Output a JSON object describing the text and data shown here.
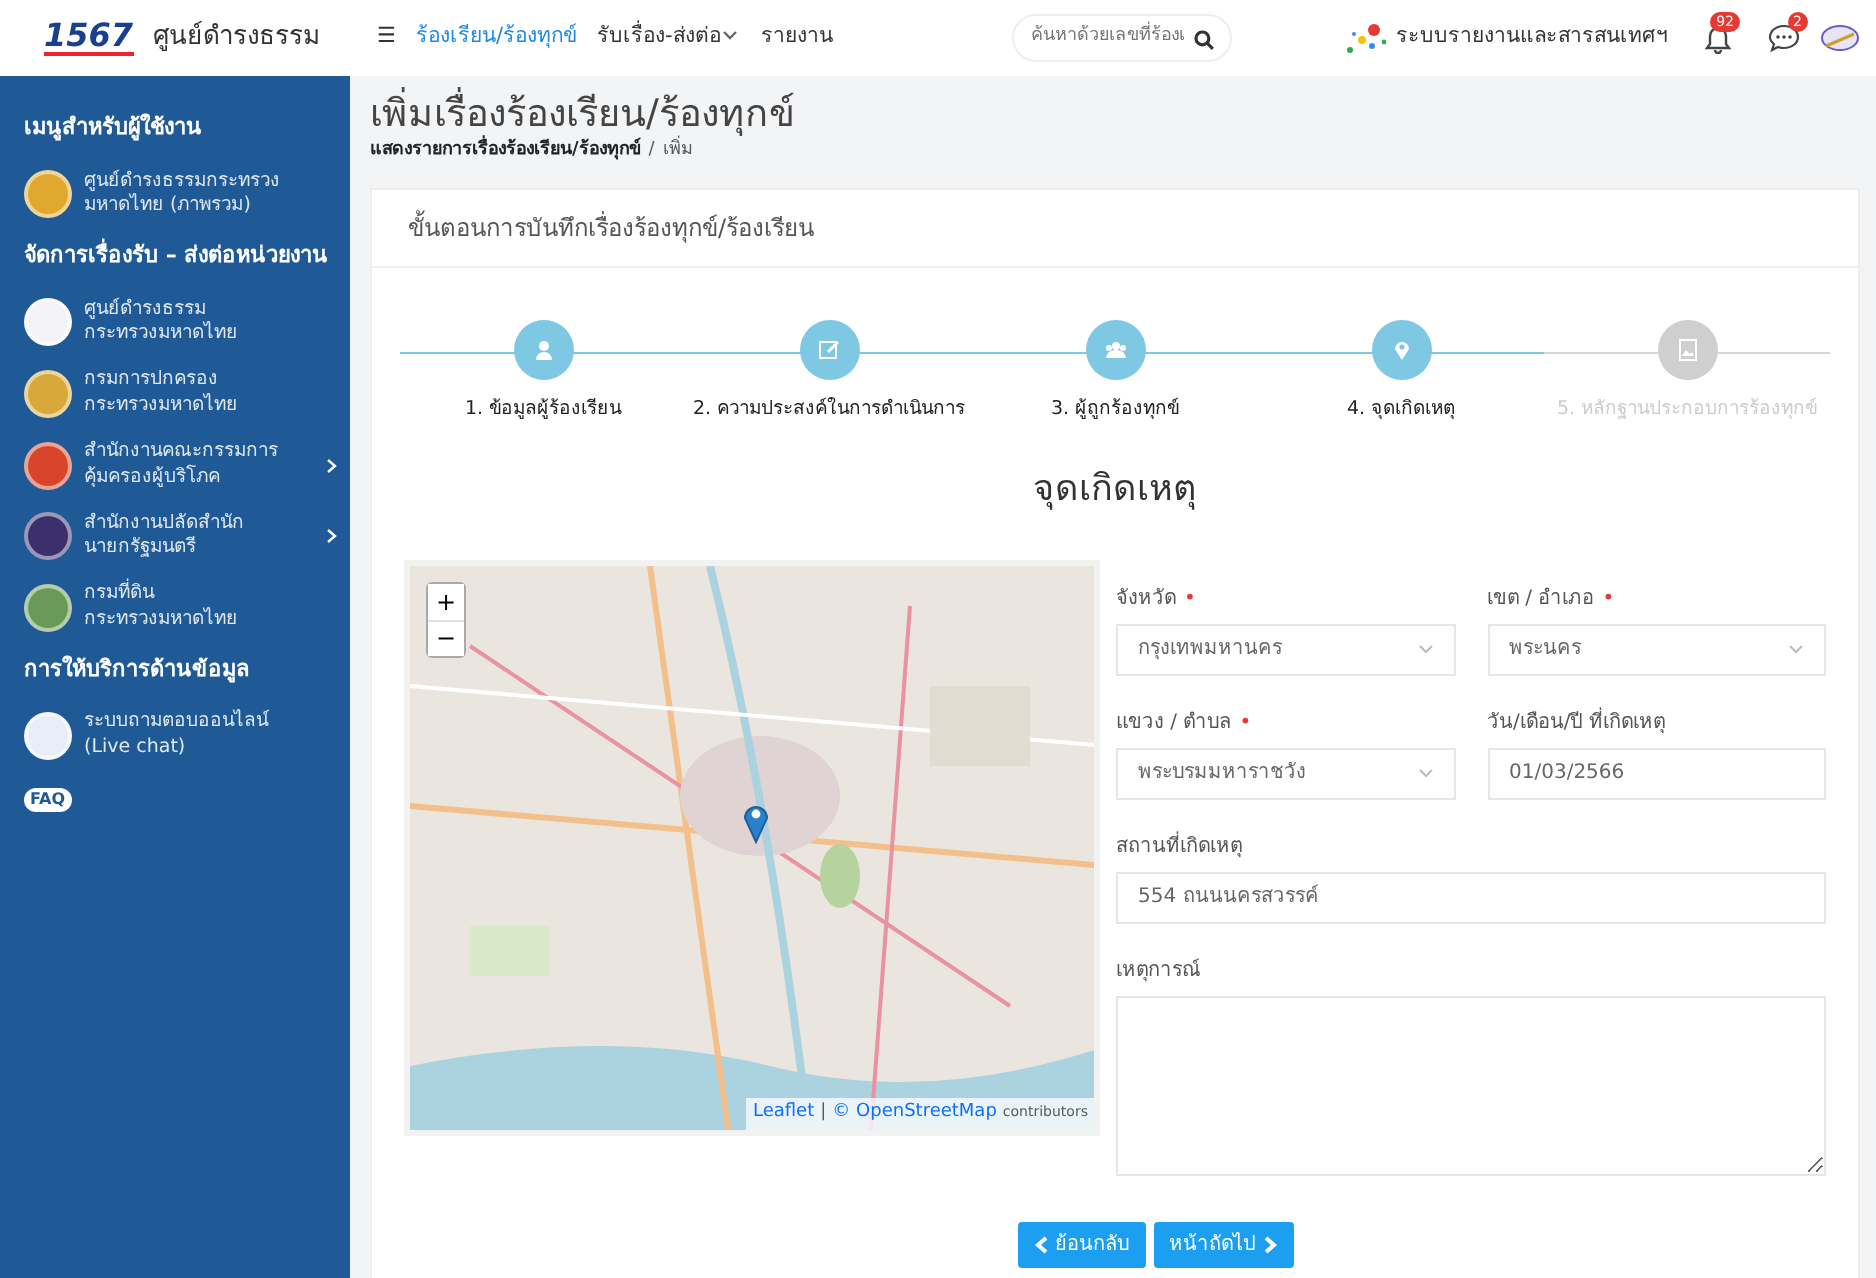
{
  "topbar": {
    "logo": "1567",
    "brand": "ศูนย์ดำรงธรรม",
    "menu_icon": "☰",
    "nav": [
      {
        "label": "ร้องเรียน/ร้องทุกข์",
        "selected": true,
        "dropdown": false
      },
      {
        "label": "รับเรื่อง-ส่งต่อ",
        "selected": false,
        "dropdown": true
      },
      {
        "label": "รายงาน",
        "selected": false,
        "dropdown": false
      }
    ],
    "search": {
      "placeholder": "ค้นหาด้วยเลขที่ร้องเ"
    },
    "report_link": "ระบบรายงานและสารสนเทศฯ",
    "notifications": [
      {
        "kind": "bell",
        "count": "92"
      },
      {
        "kind": "chat",
        "count": "2"
      }
    ]
  },
  "sidebar": {
    "sections": [
      {
        "title": "เมนูสำหรับผู้ใช้งาน",
        "items": [
          {
            "line1": "ศูนย์ดำรงธรรมกระทรวง",
            "line2": "มหาดไทย (ภาพรวม)",
            "color": "#e0a82e",
            "submenu": false
          }
        ]
      },
      {
        "title": "จัดการเรื่องรับ – ส่งต่อหน่วยงาน",
        "items": [
          {
            "line1": "ศูนย์ดำรงธรรม",
            "line2": "กระทรวงมหาดไทย",
            "color": "#f4f4f8",
            "submenu": false
          },
          {
            "line1": "กรมการปกครอง",
            "line2": "กระทรวงมหาดไทย",
            "color": "#d8a93a",
            "submenu": false
          },
          {
            "line1": "สำนักงานคณะกรรมการ",
            "line2": "คุ้มครองผู้บริโภค",
            "color": "#d9452b",
            "submenu": true
          },
          {
            "line1": "สำนักงานปลัดสำนัก",
            "line2": "นายกรัฐมนตรี",
            "color": "#3b2f6e",
            "submenu": true
          },
          {
            "line1": "กรมที่ดิน",
            "line2": "กระทรวงมหาดไทย",
            "color": "#6a9a5a",
            "submenu": false
          }
        ]
      },
      {
        "title": "การให้บริการด้านข้อมูล",
        "items": [
          {
            "line1": "ระบบถามตอบออนไลน์",
            "line2": "(Live chat)",
            "color": "#e8eef8",
            "submenu": false
          }
        ]
      }
    ],
    "faq_badge": "FAQ"
  },
  "page": {
    "title": "เพิ่มเรื่องร้องเรียน/ร้องทุกข์",
    "breadcrumb_separator": "/",
    "breadcrumb": [
      {
        "label": "แสดงรายการเรื่องร้องเรียน/ร้องทุกข์",
        "link": true
      },
      {
        "label": "เพิ่ม",
        "link": false
      }
    ]
  },
  "card": {
    "header": "ขั้นตอนการบันทึกเรื่องร้องทุกข์/ร้องเรียน",
    "steps": [
      {
        "label": "1. ข้อมูลผู้ร้องเรียน",
        "enabled": true
      },
      {
        "label": "2. ความประสงค์ในการดำเนินการ",
        "enabled": true
      },
      {
        "label": "3. ผู้ถูกร้องทุกข์",
        "enabled": true
      },
      {
        "label": "4. จุดเกิดเหตุ",
        "enabled": true
      },
      {
        "label": "5. หลักฐานประกอบการร้องทุกข์",
        "enabled": false
      }
    ],
    "required_mark": "•",
    "section_title": "จุดเกิดเหตุ",
    "map": {
      "kind": "picture",
      "zoom_in": "+",
      "zoom_out": "−",
      "attribution_lib": "Leaflet",
      "attribution_sep": "|",
      "attribution_osm": "© OpenStreetMap",
      "attribution_rest": "contributors"
    },
    "fields": [
      {
        "kind": "select",
        "label": "จังหวัด",
        "required": true,
        "value": "กรุงเทพมหานคร"
      },
      {
        "kind": "select",
        "label": "เขต / อำเภอ",
        "required": true,
        "value": "พระนคร"
      },
      {
        "kind": "select",
        "label": "แขวง / ตำบล",
        "required": true,
        "value": "พระบรมมหาราชวัง"
      },
      {
        "kind": "input",
        "label": "วัน/เดือน/ปี ที่เกิดเหตุ",
        "required": false,
        "value": "01/03/2566"
      },
      {
        "kind": "input",
        "label": "สถานที่เกิดเหตุ",
        "required": false,
        "value": "554 ถนนนครสวรรค์"
      },
      {
        "kind": "textarea",
        "label": "เหตุการณ์",
        "required": false
      }
    ],
    "buttons": [
      {
        "label": "ย้อนกลับ",
        "kind": "back"
      },
      {
        "label": "หน้าถัดไป",
        "kind": "next"
      }
    ]
  }
}
